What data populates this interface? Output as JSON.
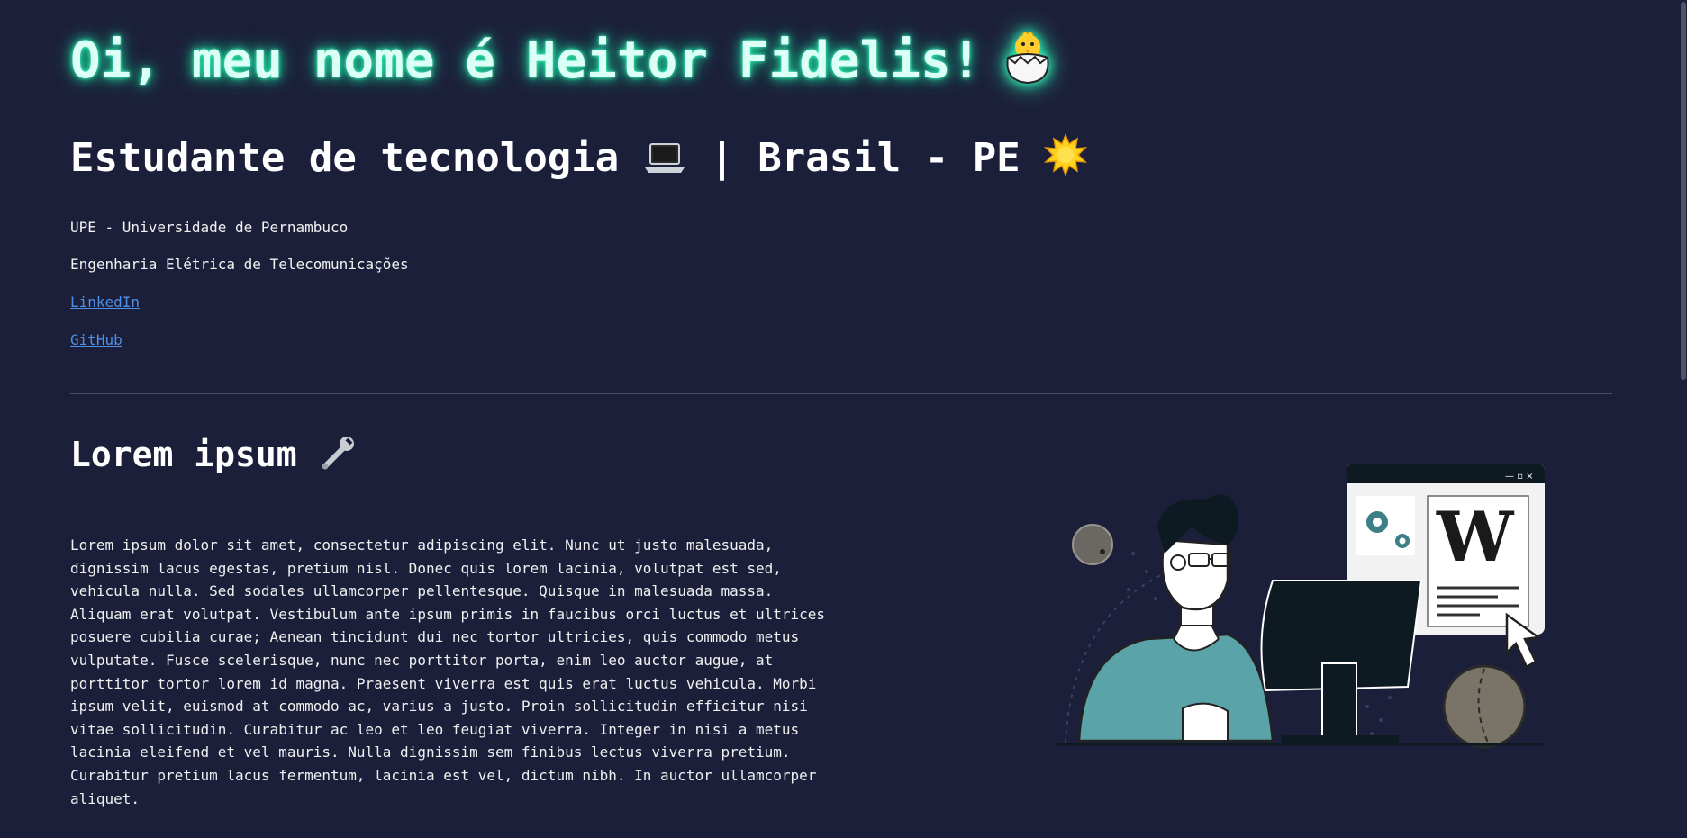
{
  "hero": {
    "title": "Oi, meu nome é Heitor Fidelis!",
    "emoji_icon": "hatching-chick-icon"
  },
  "subtitle": {
    "part1": "Estudante de tecnologia",
    "separator": "|",
    "part2": "Brasil - PE",
    "laptop_icon": "laptop-icon",
    "sun_icon": "sun-icon"
  },
  "info": {
    "university": "UPE - Universidade de Pernambuco",
    "course": "Engenharia Elétrica de Telecomunicações",
    "linkedin": "LinkedIn",
    "github": "GitHub"
  },
  "section": {
    "title": "Lorem ipsum",
    "title_icon": "wrench-icon",
    "text": "Lorem ipsum dolor sit amet, consectetur adipiscing elit. Nunc ut justo malesuada, dignissim lacus egestas, pretium nisl. Donec quis lorem lacinia, volutpat est sed, vehicula nulla. Sed sodales ullamcorper pellentesque. Quisque in malesuada massa. Aliquam erat volutpat. Vestibulum ante ipsum primis in faucibus orci luctus et ultrices posuere cubilia curae; Aenean tincidunt dui nec tortor ultricies, quis commodo metus vulputate. Fusce scelerisque, nunc nec porttitor porta, enim leo auctor augue, at porttitor tortor lorem id magna. Praesent viverra est quis erat luctus vehicula. Morbi ipsum velit, euismod at commodo ac, varius a justo. Proin sollicitudin efficitur nisi vitae sollicitudin. Curabitur ac leo et leo feugiat viverra. Integer in nisi a metus lacinia eleifend et vel mauris. Nulla dignissim sem finibus lectus viverra pretium. Curabitur pretium lacus fermentum, lacinia est vel, dictum nibh. In auctor ullamcorper aliquet."
  },
  "illustration": {
    "name": "developer-at-computer-illustration",
    "window_controls": "— ▫ ×",
    "wiki_letter": "W"
  },
  "colors": {
    "background": "#1c1f3a",
    "glow": "#20d9a0",
    "link": "#4f8fe6",
    "teal": "#5aa3a8"
  }
}
